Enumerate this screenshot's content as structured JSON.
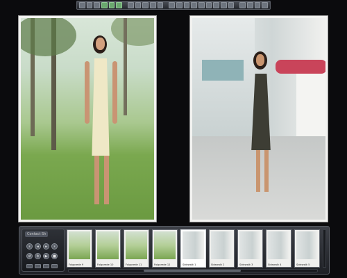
{
  "toolbar": {
    "icons": [
      "view-single-icon",
      "view-compare-icon",
      "view-grid-icon",
      "import-icon",
      "export-icon",
      "folder-icon",
      "flag-icon",
      "tag-icon",
      "rotate-icon",
      "crop-icon",
      "adjust-icon",
      "pointer-icon",
      "zoom-icon",
      "hand-icon",
      "straighten-icon",
      "brush-icon",
      "stamp-icon",
      "redeye-icon",
      "color-icon",
      "levels-icon",
      "histogram-icon",
      "info-icon",
      "loupe-icon",
      "fullscreen-icon"
    ]
  },
  "filmstrip": {
    "panel_title": "Contact Sh",
    "thumbs": [
      {
        "caption": "Folgorede 9",
        "kind": "park",
        "selected": false
      },
      {
        "caption": "Folgorede 10",
        "kind": "park",
        "selected": false
      },
      {
        "caption": "Folgorede 11",
        "kind": "park",
        "selected": false
      },
      {
        "caption": "Folgorede 12",
        "kind": "park",
        "selected": false
      },
      {
        "caption": "Sidewalk 1",
        "kind": "street",
        "selected": true
      },
      {
        "caption": "Sidewalk 2",
        "kind": "street",
        "selected": false
      },
      {
        "caption": "Sidewalk 3",
        "kind": "street",
        "selected": false
      },
      {
        "caption": "Sidewalk 4",
        "kind": "street",
        "selected": false
      },
      {
        "caption": "Sidewalk 5",
        "kind": "street",
        "selected": false
      }
    ]
  },
  "colors": {
    "accent": "#6aa86e",
    "background": "#0b0b0d"
  }
}
